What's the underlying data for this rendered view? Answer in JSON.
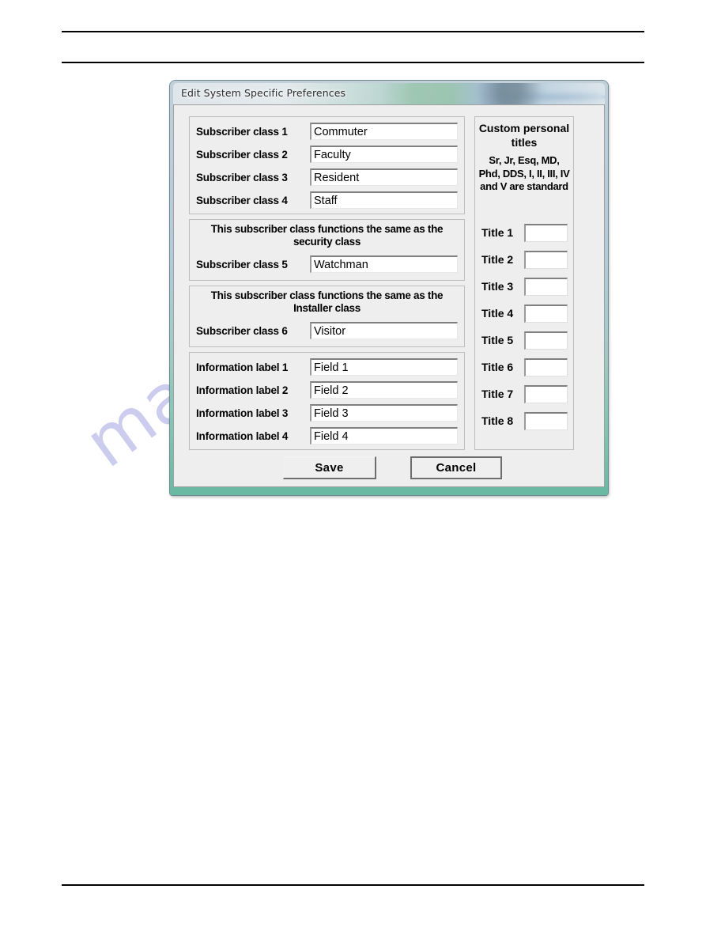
{
  "page": {
    "watermark_text": "manualshive.com",
    "rules": [
      "top-rule-1",
      "top-rule-2",
      "bottom-rule"
    ]
  },
  "dialog": {
    "title": "Edit System Specific Preferences",
    "groups": {
      "subscriber_classes_1_4": {
        "rows": [
          {
            "label": "Subscriber class 1",
            "value": "Commuter"
          },
          {
            "label": "Subscriber class 2",
            "value": "Faculty"
          },
          {
            "label": "Subscriber class 3",
            "value": "Resident"
          },
          {
            "label": "Subscriber class 4",
            "value": "Staff"
          }
        ]
      },
      "subscriber_class_5": {
        "note": "This subscriber class functions the same as the security class",
        "row": {
          "label": "Subscriber class 5",
          "value": "Watchman"
        }
      },
      "subscriber_class_6": {
        "note": "This subscriber class functions the same as the Installer class",
        "row": {
          "label": "Subscriber class 6",
          "value": "Visitor"
        }
      },
      "information_labels": {
        "rows": [
          {
            "label": "Information label 1",
            "value": "Field 1"
          },
          {
            "label": "Information label 2",
            "value": "Field 2"
          },
          {
            "label": "Information label 3",
            "value": "Field 3"
          },
          {
            "label": "Information label 4",
            "value": "Field 4"
          }
        ]
      },
      "custom_titles": {
        "heading": "Custom personal titles",
        "standard_note": "Sr, Jr, Esq, MD, Phd, DDS, I, II, III, IV and V are standard",
        "rows": [
          {
            "label": "Title 1",
            "value": ""
          },
          {
            "label": "Title 2",
            "value": ""
          },
          {
            "label": "Title 3",
            "value": ""
          },
          {
            "label": "Title 4",
            "value": ""
          },
          {
            "label": "Title 5",
            "value": ""
          },
          {
            "label": "Title 6",
            "value": ""
          },
          {
            "label": "Title 7",
            "value": ""
          },
          {
            "label": "Title 8",
            "value": ""
          }
        ]
      }
    },
    "buttons": {
      "save": "Save",
      "cancel": "Cancel"
    }
  },
  "colors": {
    "dialog_face": "#eeeeee",
    "group_border": "#bdbdbd",
    "frame_top": "#becdd7",
    "frame_bottom": "#68b9a2",
    "watermark": "#ccccee",
    "text": "#000000"
  }
}
